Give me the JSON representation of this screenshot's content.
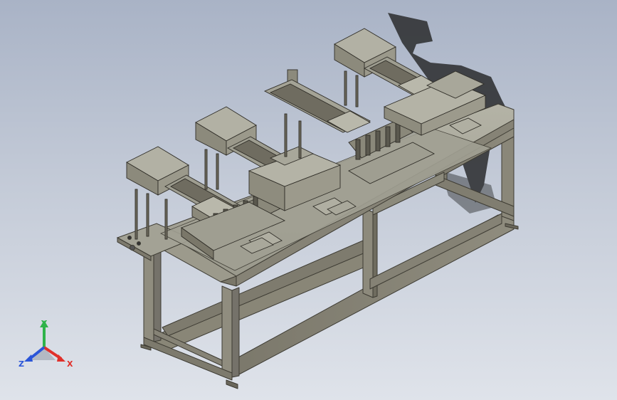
{
  "viewport": {
    "background_top": "#a9b3c6",
    "background_bottom": "#dfe3ea"
  },
  "model": {
    "frame_color": "#8e8b7c",
    "frame_dark": "#6d6a5d",
    "module_color": "#a8a79a",
    "shadow_color": "#2a2b2d"
  },
  "triad": {
    "x_label": "X",
    "y_label": "Y",
    "z_label": "Z",
    "x_color": "#e0302a",
    "y_color": "#2fb34a",
    "z_color": "#2a55d8"
  }
}
